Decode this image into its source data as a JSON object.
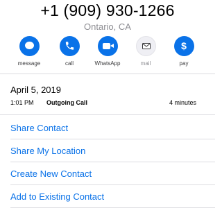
{
  "contact": {
    "phone_number": "+1 (909) 930-1266",
    "location": "Ontario, CA"
  },
  "actions": [
    {
      "label": "message",
      "icon": "message-icon",
      "enabled": true
    },
    {
      "label": "call",
      "icon": "phone-icon",
      "enabled": true
    },
    {
      "label": "WhatsApp",
      "icon": "video-icon",
      "enabled": true
    },
    {
      "label": "mail",
      "icon": "mail-icon",
      "enabled": false
    },
    {
      "label": "pay",
      "icon": "dollar-icon",
      "enabled": true
    }
  ],
  "call_log": {
    "date": "April 5, 2019",
    "entries": [
      {
        "time": "1:01 PM",
        "type": "Outgoing Call",
        "duration": "4 minutes"
      }
    ]
  },
  "menu": [
    {
      "label": "Share Contact"
    },
    {
      "label": "Share My Location"
    },
    {
      "label": "Create New Contact"
    },
    {
      "label": "Add to Existing Contact"
    }
  ],
  "colors": {
    "accent": "#0a72e8",
    "secondary_text": "#8e8e93",
    "divider": "#dcdce0"
  }
}
